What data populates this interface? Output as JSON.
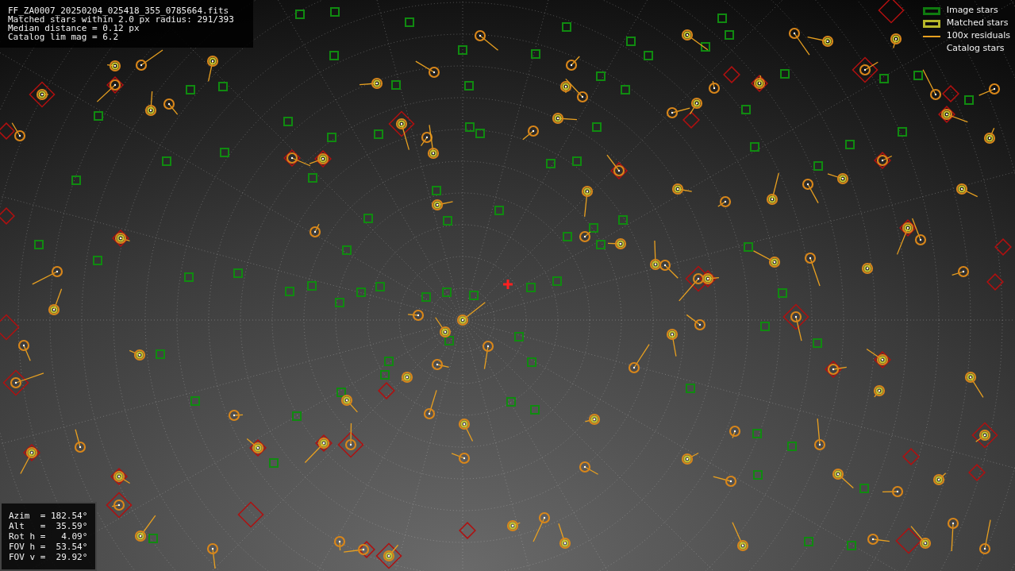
{
  "info_box": {
    "lines": [
      "FF_ZA0007_20250204_025418_355_0785664.fits",
      "Matched stars within 2.0 px radius: 291/393",
      "Median distance = 0.12 px",
      "Catalog lim mag = 6.2"
    ]
  },
  "legend": {
    "items": [
      {
        "label": "Image stars",
        "kind": "square",
        "color": "#0f7a0f"
      },
      {
        "label": "Matched stars",
        "kind": "square",
        "color": "#b8b82a"
      },
      {
        "label": "100x residuals",
        "kind": "line",
        "color": "#e8a020"
      },
      {
        "label": "Catalog stars",
        "kind": "none"
      }
    ]
  },
  "pointing_box": {
    "lines": [
      "Azim  = 182.54°",
      "Alt   =  35.59°",
      "Rot h =   4.09°",
      "FOV h =  53.54°",
      "FOV v =  29.92°"
    ]
  }
}
